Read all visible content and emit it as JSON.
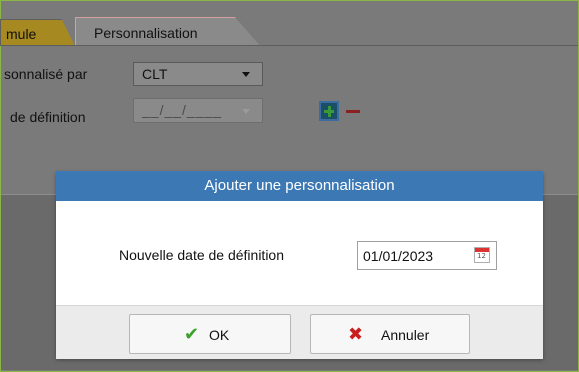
{
  "tabs": [
    {
      "label": "mule"
    },
    {
      "label": "Personnalisation"
    }
  ],
  "form": {
    "personalized_by_label": "sonnalisé par",
    "personalized_by_value": "CLT",
    "definition_date_label": "de définition",
    "definition_date_value": "__/__/____"
  },
  "dialog": {
    "title": "Ajouter une personnalisation",
    "field_label": "Nouvelle date de définition",
    "date_value": "01/01/2023",
    "ok_label": "OK",
    "cancel_label": "Annuler",
    "ok_icon": "check-icon",
    "cancel_icon": "x-icon"
  },
  "colors": {
    "title_bar": "#3c78b4",
    "ok_icon": "#3aa12a",
    "cancel_icon": "#c81e1e",
    "tab_formule": "#a68920"
  }
}
